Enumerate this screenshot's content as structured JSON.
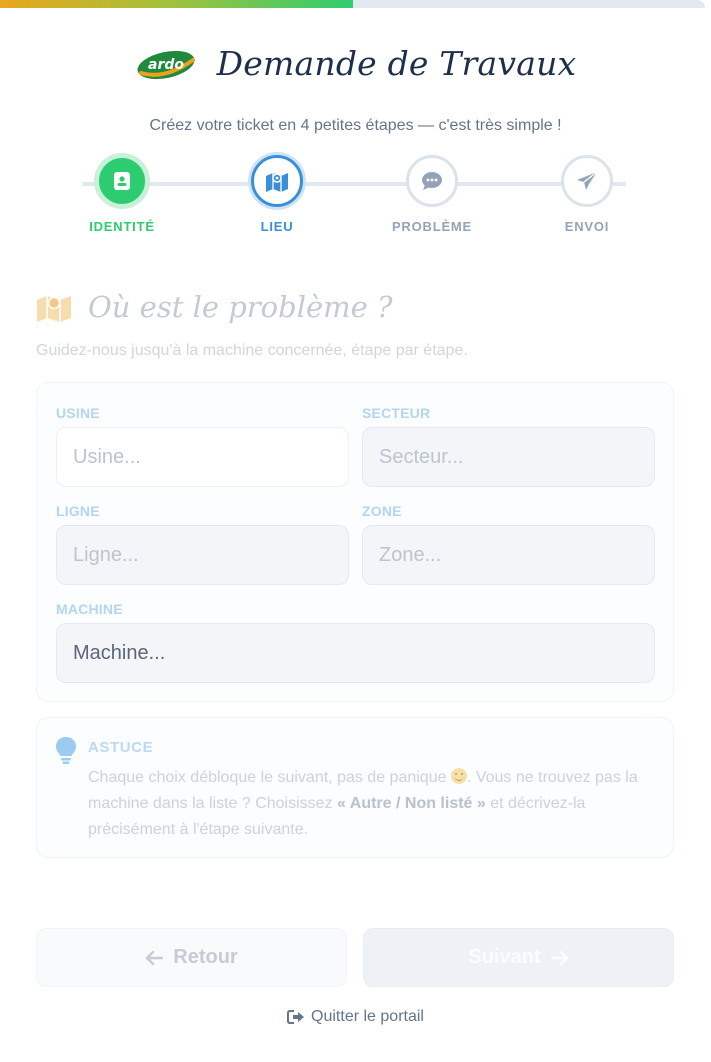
{
  "progress": {
    "fraction": 0.5
  },
  "header": {
    "brand": "ardo",
    "title": "Demande de Travaux",
    "subtitle": "Créez votre ticket en 4 petites étapes — c'est très simple !"
  },
  "steps": [
    {
      "label": "IDENTITÉ",
      "icon": "id-badge-icon",
      "state": "done"
    },
    {
      "label": "LIEU",
      "icon": "map-icon",
      "state": "active"
    },
    {
      "label": "PROBLÈME",
      "icon": "comment-icon",
      "state": "pending"
    },
    {
      "label": "ENVOI",
      "icon": "paper-plane-icon",
      "state": "pending"
    }
  ],
  "section": {
    "title": "Où est le problème ?",
    "description": "Guidez-nous jusqu'à la machine concernée, étape par étape."
  },
  "form": {
    "usine": {
      "label": "USINE",
      "placeholder": "Usine..."
    },
    "secteur": {
      "label": "SECTEUR",
      "placeholder": "Secteur..."
    },
    "ligne": {
      "label": "LIGNE",
      "placeholder": "Ligne..."
    },
    "zone": {
      "label": "ZONE",
      "placeholder": "Zone..."
    },
    "machine": {
      "label": "MACHINE",
      "placeholder": "Machine..."
    }
  },
  "tip": {
    "title": "ASTUCE",
    "text_before": "Chaque choix débloque le suivant, pas de panique",
    "text_middle": ". Vous ne trouvez pas la machine dans la liste ? Choisissez",
    "highlight": "« Autre / Non listé »",
    "text_after": "et décrivez-la précisément à l'étape suivante."
  },
  "nav": {
    "back_label": "Retour",
    "next_label": "Suivant",
    "quit_label": "Quitter le portail"
  },
  "colors": {
    "done": "#2ecc71",
    "active": "#3a8fd9",
    "pending": "#94a3b8",
    "title": "#1e2f4a"
  }
}
